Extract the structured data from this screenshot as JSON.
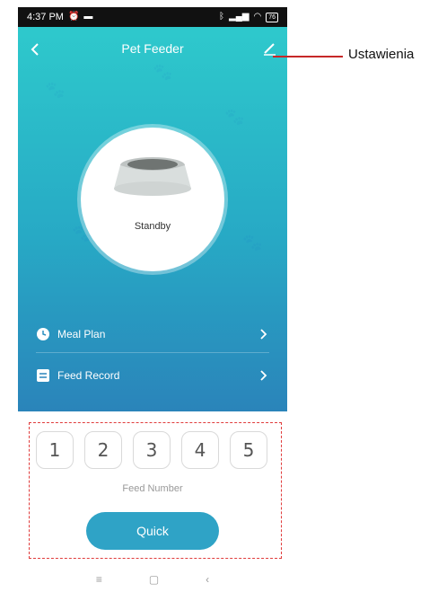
{
  "status_bar": {
    "time": "4:37 PM",
    "battery": "76"
  },
  "header": {
    "title": "Pet Feeder"
  },
  "device": {
    "status": "Standby"
  },
  "menu": {
    "meal_plan": "Meal Plan",
    "feed_record": "Feed Record"
  },
  "feed": {
    "numbers": [
      "1",
      "2",
      "3",
      "4",
      "5"
    ],
    "label": "Feed Number",
    "quick": "Quick"
  },
  "annotation": {
    "label": "Ustawienia",
    "color": "#c62828"
  },
  "colors": {
    "accent": "#2fa3c6",
    "gradient_top": "#2ec9cc",
    "gradient_bottom": "#2a84ba",
    "dashed_box": "#e03b3b"
  },
  "icons": {
    "back": "chevron-left-icon",
    "edit": "pencil-icon",
    "meal": "clock-icon",
    "record": "list-icon",
    "chevron": "chevron-right-icon"
  }
}
